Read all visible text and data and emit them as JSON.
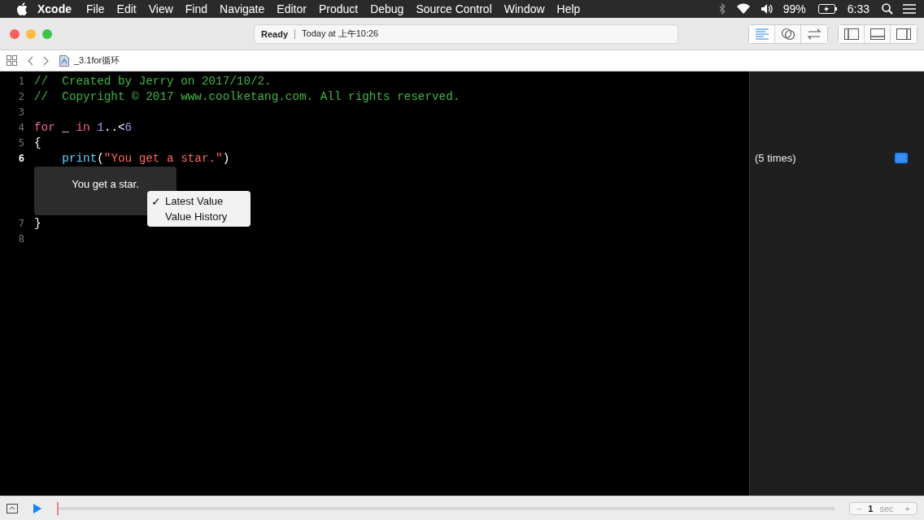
{
  "menubar": {
    "app": "Xcode",
    "items": [
      "File",
      "Edit",
      "View",
      "Find",
      "Navigate",
      "Editor",
      "Product",
      "Debug",
      "Source Control",
      "Window",
      "Help"
    ],
    "battery": "99%",
    "time": "6:33"
  },
  "toolbar": {
    "status": "Ready",
    "activity": "Today at 上午10:26",
    "editor_modes": [
      {
        "kind": "standard",
        "selected": true
      },
      {
        "kind": "assistant",
        "selected": false
      },
      {
        "kind": "version",
        "selected": false
      }
    ]
  },
  "jumpbar": {
    "file": "_3.1for循环"
  },
  "editor": {
    "lines": [
      {
        "number": "1",
        "current": false,
        "tokens": [
          {
            "text": "//  Created by Jerry on 2017/10/2.",
            "kind": "comment"
          }
        ]
      },
      {
        "number": "2",
        "current": false,
        "tokens": [
          {
            "text": "//  Copyright © 2017 www.coolketang.com. All rights reserved.",
            "kind": "comment"
          }
        ]
      },
      {
        "number": "3",
        "current": false
      },
      {
        "number": "4",
        "current": false,
        "tokens": [
          {
            "text": "for",
            "kind": "keyword"
          },
          {
            "text": " _ ",
            "kind": "plain"
          },
          {
            "text": "in",
            "kind": "keyword"
          },
          {
            "text": " 1",
            "kind": "number"
          },
          {
            "text": "..<",
            "kind": "plain"
          },
          {
            "text": "6",
            "kind": "number"
          }
        ]
      },
      {
        "number": "5",
        "current": false,
        "tokens": [
          {
            "text": "{",
            "kind": "plain"
          }
        ]
      },
      {
        "number": "6",
        "current": true,
        "tokens": [
          {
            "text": "    print",
            "kind": "function"
          },
          {
            "text": "(",
            "kind": "plain"
          },
          {
            "text": "\"You get a star.\"",
            "kind": "string"
          },
          {
            "text": ")",
            "kind": "plain"
          }
        ],
        "result": "(5 times)",
        "inline_result": "You get a star."
      },
      {
        "number": "7",
        "current": false,
        "tokens": [
          {
            "text": "}",
            "kind": "plain"
          }
        ]
      },
      {
        "number": "8",
        "current": false
      }
    ],
    "popup": {
      "check": "✓",
      "items": [
        {
          "label": "Latest Value",
          "checked": true
        },
        {
          "label": "Value History",
          "checked": false
        }
      ]
    }
  },
  "bottom": {
    "timeline": {
      "level": 0
    },
    "stepper": {
      "minus": "−",
      "value": "1",
      "unit": "sec",
      "plus": "+"
    }
  }
}
